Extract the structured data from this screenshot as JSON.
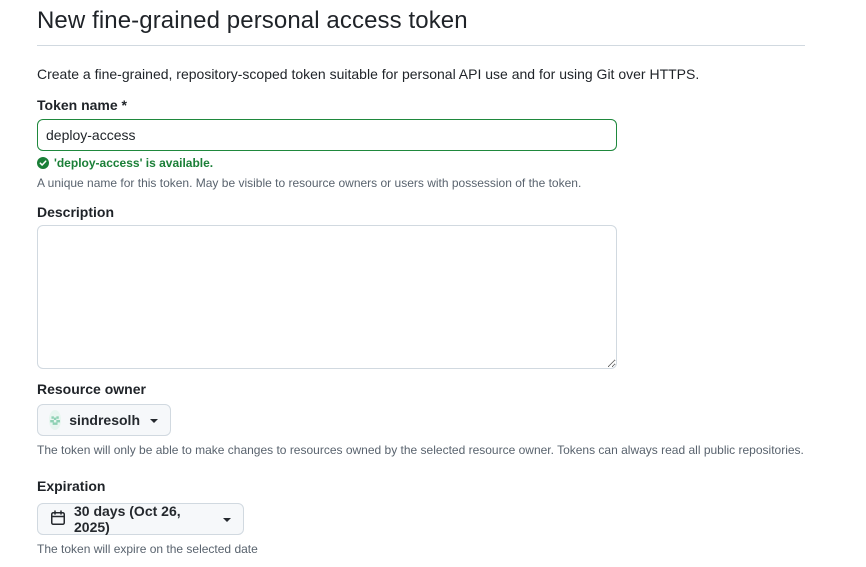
{
  "page": {
    "title": "New fine-grained personal access token",
    "intro": "Create a fine-grained, repository-scoped token suitable for personal API use and for using Git over HTTPS."
  },
  "token_name": {
    "label": "Token name *",
    "value": "deploy-access",
    "validation": "'deploy-access' is available.",
    "hint": "A unique name for this token. May be visible to resource owners or users with possession of the token."
  },
  "description": {
    "label": "Description",
    "value": ""
  },
  "resource_owner": {
    "label": "Resource owner",
    "selected": "sindresolh",
    "hint": "The token will only be able to make changes to resources owned by the selected resource owner. Tokens can always read all public repositories."
  },
  "expiration": {
    "label": "Expiration",
    "selected": "30 days (Oct 26, 2025)",
    "hint": "The token will expire on the selected date"
  },
  "colors": {
    "success": "#1a7f37",
    "border": "#d1d9e0",
    "button_bg": "#f6f8fa",
    "muted_text": "#59636e"
  },
  "icons": {
    "validation": "check-circle-fill-icon",
    "expiration": "calendar-icon",
    "dropdown": "triangle-down-icon"
  }
}
